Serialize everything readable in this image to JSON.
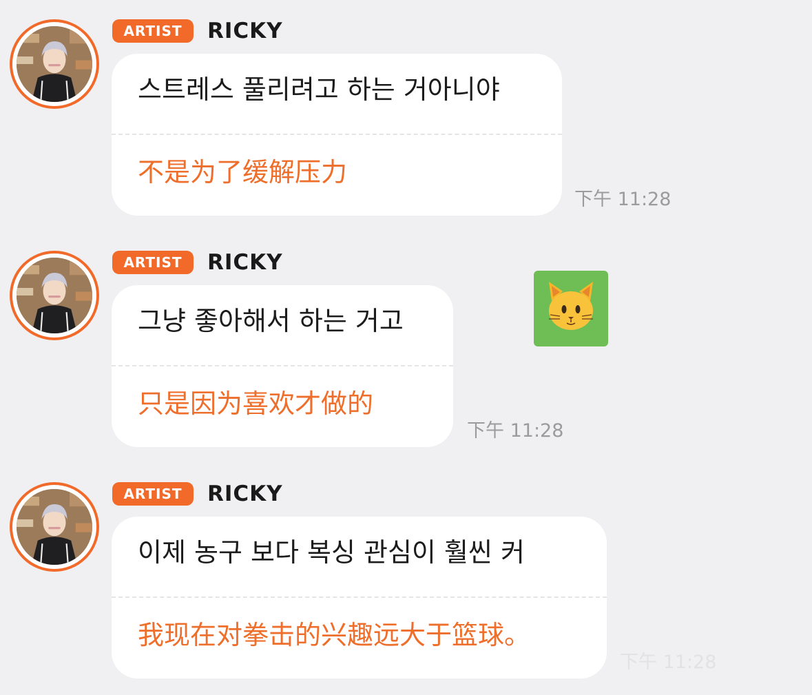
{
  "messages": [
    {
      "badge": "ARTIST",
      "sender": "RICKY",
      "original": "스트레스 풀리려고 하는 거아니야",
      "translation": "不是为了缓解压力",
      "time": "下午 11:28"
    },
    {
      "badge": "ARTIST",
      "sender": "RICKY",
      "original": "그냥 좋아해서 하는 거고",
      "translation": "只是因为喜欢才做的",
      "time": "下午 11:28",
      "reaction_icon": "cat-face-icon"
    },
    {
      "badge": "ARTIST",
      "sender": "RICKY",
      "original": "이제 농구 보다 복싱 관심이 훨씬 커",
      "translation": "我现在对拳击的兴趣远大于篮球。",
      "time": "下午 11:28"
    }
  ],
  "colors": {
    "accent": "#f26a2a",
    "translation_text": "#ee6e2b",
    "background": "#f0f0f2",
    "bubble": "#ffffff",
    "timestamp": "#9b9b9b",
    "reaction_bg": "#6fbe55"
  }
}
